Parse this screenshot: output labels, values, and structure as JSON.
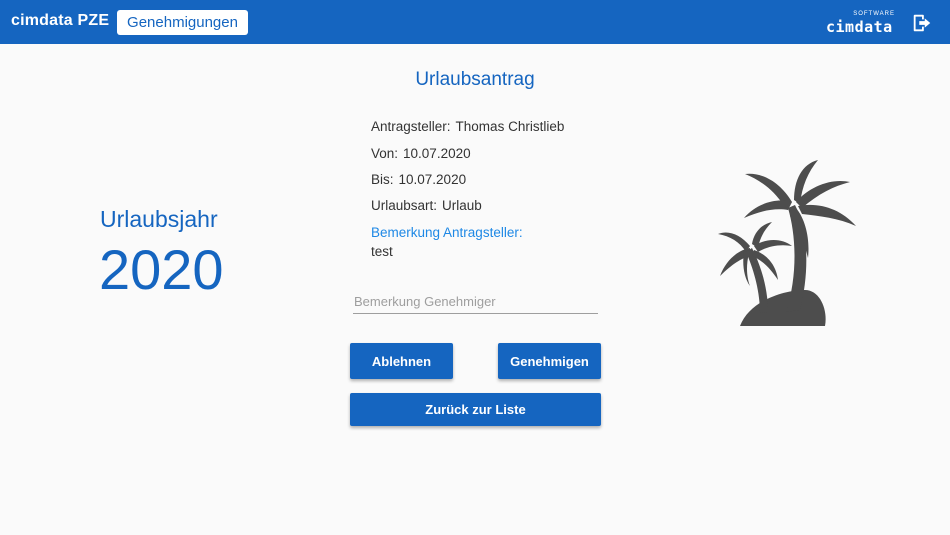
{
  "header": {
    "app_title": "cimdata PZE",
    "nav_button": "Genehmigungen",
    "brand": {
      "small": "SOFTWARE",
      "main": "cimdata"
    },
    "logout_icon": "logout-icon"
  },
  "year": {
    "label": "Urlaubsjahr",
    "value": "2020"
  },
  "form": {
    "title": "Urlaubsantrag",
    "applicant_label": "Antragsteller:",
    "applicant_value": "Thomas Christlieb",
    "from_label": "Von:",
    "from_value": "10.07.2020",
    "to_label": "Bis:",
    "to_value": "10.07.2020",
    "type_label": "Urlaubsart:",
    "type_value": "Urlaub",
    "remark_label": "Bemerkung Antragsteller:",
    "remark_value": "test",
    "approver_placeholder": "Bemerkung Genehmiger",
    "approver_value": ""
  },
  "buttons": {
    "reject": "Ablehnen",
    "approve": "Genehmigen",
    "back": "Zurück zur Liste"
  },
  "illustration": {
    "icon": "palm-trees-icon"
  },
  "colors": {
    "primary": "#1565c0",
    "accent_text": "#1e88e5",
    "illustration": "#4d4d4d",
    "background": "#fafafa"
  }
}
